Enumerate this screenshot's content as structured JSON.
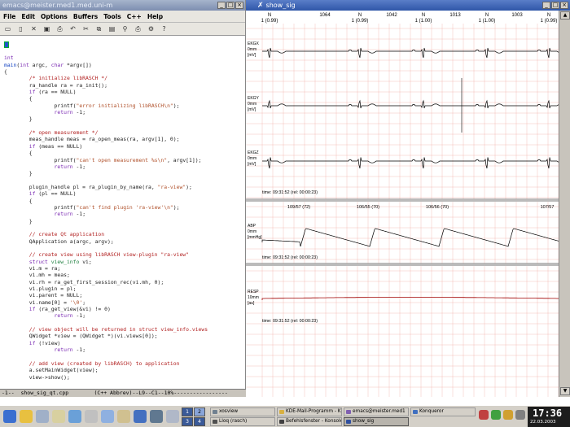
{
  "emacs": {
    "title": "emacs@meister.med1.med.uni-m",
    "menu": [
      "File",
      "Edit",
      "Options",
      "Buffers",
      "Tools",
      "C++",
      "Help"
    ],
    "tools": [
      "open-folder-icon",
      "open-file-icon",
      "close-icon",
      "save-icon",
      "print-icon",
      "undo-icon",
      "cut-icon",
      "copy-icon",
      "paste-icon",
      "search-icon",
      "print-icon",
      "settings-icon",
      "help-icon"
    ],
    "code": [
      [
        [
          "c-plain",
          ""
        ]
      ],
      [
        [
          "c-kw",
          "int"
        ]
      ],
      [
        [
          "c-fn",
          "main"
        ],
        [
          "c-plain",
          "("
        ],
        [
          "c-kw",
          "int"
        ],
        [
          "c-plain",
          " argc, "
        ],
        [
          "c-kw",
          "char"
        ],
        [
          "c-plain",
          " *argv[])"
        ]
      ],
      [
        [
          "c-plain",
          "{"
        ]
      ],
      [
        [
          "c-cm",
          "        /* initialize libRASCH */"
        ]
      ],
      [
        [
          "c-plain",
          "        ra_handle ra = ra_init();"
        ]
      ],
      [
        [
          "c-kw",
          "        if"
        ],
        [
          "c-plain",
          " (ra == NULL)"
        ]
      ],
      [
        [
          "c-plain",
          "        {"
        ]
      ],
      [
        [
          "c-plain",
          "                printf("
        ],
        [
          "c-st",
          "\"error initializing libRASCH\\n\""
        ],
        [
          "c-plain",
          ");"
        ]
      ],
      [
        [
          "c-kw",
          "                return"
        ],
        [
          "c-plain",
          " -1;"
        ]
      ],
      [
        [
          "c-plain",
          "        }"
        ]
      ],
      [
        [
          "c-plain",
          ""
        ]
      ],
      [
        [
          "c-cm",
          "        /* open measurement */"
        ]
      ],
      [
        [
          "c-plain",
          "        meas_handle meas = ra_open_meas(ra, argv[1], 0);"
        ]
      ],
      [
        [
          "c-kw",
          "        if"
        ],
        [
          "c-plain",
          " (meas == NULL)"
        ]
      ],
      [
        [
          "c-plain",
          "        {"
        ]
      ],
      [
        [
          "c-plain",
          "                printf("
        ],
        [
          "c-st",
          "\"can't open measurement %s\\n\""
        ],
        [
          "c-plain",
          ", argv[1]);"
        ]
      ],
      [
        [
          "c-kw",
          "                return"
        ],
        [
          "c-plain",
          " -1;"
        ]
      ],
      [
        [
          "c-plain",
          "        }"
        ]
      ],
      [
        [
          "c-plain",
          ""
        ]
      ],
      [
        [
          "c-plain",
          "        plugin_handle pl = ra_plugin_by_name(ra, "
        ],
        [
          "c-st",
          "\"ra-view\""
        ],
        [
          "c-plain",
          ");"
        ]
      ],
      [
        [
          "c-kw",
          "        if"
        ],
        [
          "c-plain",
          " (pl == NULL)"
        ]
      ],
      [
        [
          "c-plain",
          "        {"
        ]
      ],
      [
        [
          "c-plain",
          "                printf("
        ],
        [
          "c-st",
          "\"can't find plugin 'ra-view'\\n\""
        ],
        [
          "c-plain",
          ");"
        ]
      ],
      [
        [
          "c-kw",
          "                return"
        ],
        [
          "c-plain",
          " -1;"
        ]
      ],
      [
        [
          "c-plain",
          "        }"
        ]
      ],
      [
        [
          "c-plain",
          ""
        ]
      ],
      [
        [
          "c-cm",
          "        // create Qt application"
        ]
      ],
      [
        [
          "c-plain",
          "        QApplication a(argc, argv);"
        ]
      ],
      [
        [
          "c-plain",
          ""
        ]
      ],
      [
        [
          "c-cm",
          "        // create view using libRASCH view-plugin \"ra-view\""
        ]
      ],
      [
        [
          "c-kw",
          "        struct"
        ],
        [
          "c-ty",
          " view_info"
        ],
        [
          "c-plain",
          " vi;"
        ]
      ],
      [
        [
          "c-plain",
          "        vi.m = ra;"
        ]
      ],
      [
        [
          "c-plain",
          "        vi.mh = meas;"
        ]
      ],
      [
        [
          "c-plain",
          "        vi.rh = ra_get_first_session_rec(vi.mh, 0);"
        ]
      ],
      [
        [
          "c-plain",
          "        vi.plugin = pl;"
        ]
      ],
      [
        [
          "c-plain",
          "        vi.parent = NULL;"
        ]
      ],
      [
        [
          "c-plain",
          "        vi.name[0] = "
        ],
        [
          "c-st",
          "'\\0'"
        ],
        [
          "c-plain",
          ";"
        ]
      ],
      [
        [
          "c-kw",
          "        if"
        ],
        [
          "c-plain",
          " (ra_get_view(&vi) != 0)"
        ]
      ],
      [
        [
          "c-kw",
          "                return"
        ],
        [
          "c-plain",
          " -1;"
        ]
      ],
      [
        [
          "c-plain",
          ""
        ]
      ],
      [
        [
          "c-cm",
          "        // view object will be returned in struct view_info.views"
        ]
      ],
      [
        [
          "c-plain",
          "        QWidget *view = (QWidget *)(vi.views[0]);"
        ]
      ],
      [
        [
          "c-kw",
          "        if"
        ],
        [
          "c-plain",
          " (!view)"
        ]
      ],
      [
        [
          "c-kw",
          "                return"
        ],
        [
          "c-plain",
          " -1;"
        ]
      ],
      [
        [
          "c-plain",
          ""
        ]
      ],
      [
        [
          "c-cm",
          "        // add view (created by libRASCH) to application"
        ]
      ],
      [
        [
          "c-plain",
          "        a.setMainWidget(view);"
        ]
      ],
      [
        [
          "c-plain",
          "        view->show();"
        ]
      ],
      [
        [
          "c-plain",
          ""
        ]
      ],
      [
        [
          "c-kw",
          "        return"
        ],
        [
          "c-plain",
          " a.exec();"
        ]
      ],
      [
        [
          "c-plain",
          "}"
        ]
      ]
    ],
    "modeline": "-1--  show_sig_qt.cpp        (C++ Abbrev)--L9--C1--10%-----------------"
  },
  "showsig": {
    "title": "show_sig",
    "ecg_header": {
      "beat_labels": [
        "N",
        "N",
        "N",
        "N",
        "N"
      ],
      "beat_subs": [
        "1 (0.99)",
        "1 (0.99)",
        "1 (1.00)",
        "1 (1.00)",
        "1 (0.99)"
      ],
      "rr": [
        "1064",
        "1042",
        "1013",
        "1003"
      ]
    },
    "channels": {
      "ekg1": [
        "EKGX",
        "0mm",
        "[mV]"
      ],
      "ekg2": [
        "EKGY",
        "0mm",
        "[mV]"
      ],
      "ekg3": [
        "EKGZ",
        "0mm",
        "[mV]"
      ],
      "abp": [
        "ABP",
        "0mm",
        "[mmHg]"
      ],
      "resp": [
        "RESP",
        "10mm",
        "[au]"
      ]
    },
    "time1": "time: 09:31:52 (rel: 00:00:23)",
    "time2": "time: 09:31:52 (rel: 00:00:23)",
    "time3": "time: 09:31:52 (rel: 00:00:23)",
    "bp_labels": [
      "109/57 (72)",
      "106/55 (70)",
      "106/56 (70)",
      "107/57"
    ],
    "colors": {
      "grid": "#f0b0a8",
      "ecg": "#000000",
      "resp": "#a00000"
    }
  },
  "taskbar": {
    "pager": [
      "1",
      "2",
      "3",
      "4"
    ],
    "tasks": {
      "t1": "xosview",
      "t2": "Lloq (rasch)",
      "t3": "KDE-Mail-Programm - K",
      "t4": "Befehlsfenster - Konsole",
      "t5": "emacs@meister.med1",
      "t6": "show_sig",
      "t7": "Konqueror"
    },
    "clock_time": "17:36",
    "clock_date": "22.03.2003"
  }
}
